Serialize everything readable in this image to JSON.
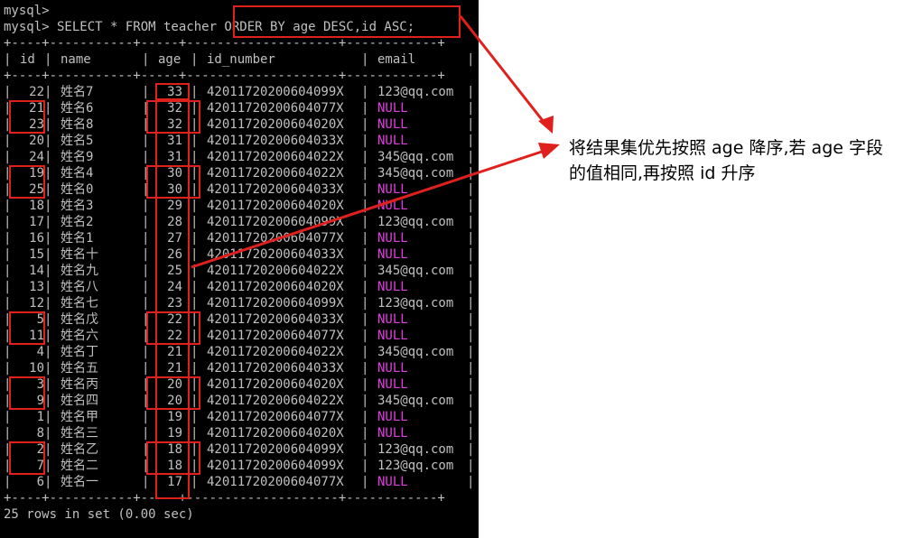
{
  "terminal": {
    "prompt_lines": [
      "mysql>",
      "mysql> SELECT * FROM teacher ORDER BY age DESC,id ASC;"
    ],
    "border_line": "+----+-----------+-----+--------------------+------------+",
    "header": {
      "id": "id",
      "name": "name",
      "age": "age",
      "id_number": "id_number",
      "email": "email"
    },
    "rows": [
      {
        "id": "22",
        "name": "姓名7",
        "age": "33",
        "id_number": "42011720200604099X",
        "email": "123@qq.com"
      },
      {
        "id": "21",
        "name": "姓名6",
        "age": "32",
        "id_number": "42011720200604077X",
        "email": "NULL"
      },
      {
        "id": "23",
        "name": "姓名8",
        "age": "32",
        "id_number": "42011720200604020X",
        "email": "NULL"
      },
      {
        "id": "20",
        "name": "姓名5",
        "age": "31",
        "id_number": "42011720200604033X",
        "email": "NULL"
      },
      {
        "id": "24",
        "name": "姓名9",
        "age": "31",
        "id_number": "42011720200604022X",
        "email": "345@qq.com"
      },
      {
        "id": "19",
        "name": "姓名4",
        "age": "30",
        "id_number": "42011720200604022X",
        "email": "345@qq.com"
      },
      {
        "id": "25",
        "name": "姓名0",
        "age": "30",
        "id_number": "42011720200604033X",
        "email": "NULL"
      },
      {
        "id": "18",
        "name": "姓名3",
        "age": "29",
        "id_number": "42011720200604020X",
        "email": "NULL"
      },
      {
        "id": "17",
        "name": "姓名2",
        "age": "28",
        "id_number": "42011720200604099X",
        "email": "123@qq.com"
      },
      {
        "id": "16",
        "name": "姓名1",
        "age": "27",
        "id_number": "42011720200604077X",
        "email": "NULL"
      },
      {
        "id": "15",
        "name": "姓名十",
        "age": "26",
        "id_number": "42011720200604033X",
        "email": "NULL"
      },
      {
        "id": "14",
        "name": "姓名九",
        "age": "25",
        "id_number": "42011720200604022X",
        "email": "345@qq.com"
      },
      {
        "id": "13",
        "name": "姓名八",
        "age": "24",
        "id_number": "42011720200604020X",
        "email": "NULL"
      },
      {
        "id": "12",
        "name": "姓名七",
        "age": "23",
        "id_number": "42011720200604099X",
        "email": "123@qq.com"
      },
      {
        "id": "5",
        "name": "姓名戊",
        "age": "22",
        "id_number": "42011720200604033X",
        "email": "NULL"
      },
      {
        "id": "11",
        "name": "姓名六",
        "age": "22",
        "id_number": "42011720200604077X",
        "email": "NULL"
      },
      {
        "id": "4",
        "name": "姓名丁",
        "age": "21",
        "id_number": "42011720200604022X",
        "email": "345@qq.com"
      },
      {
        "id": "10",
        "name": "姓名五",
        "age": "21",
        "id_number": "42011720200604033X",
        "email": "NULL"
      },
      {
        "id": "3",
        "name": "姓名丙",
        "age": "20",
        "id_number": "42011720200604020X",
        "email": "NULL"
      },
      {
        "id": "9",
        "name": "姓名四",
        "age": "20",
        "id_number": "42011720200604022X",
        "email": "345@qq.com"
      },
      {
        "id": "1",
        "name": "姓名甲",
        "age": "19",
        "id_number": "42011720200604077X",
        "email": "NULL"
      },
      {
        "id": "8",
        "name": "姓名三",
        "age": "19",
        "id_number": "42011720200604020X",
        "email": "NULL"
      },
      {
        "id": "2",
        "name": "姓名乙",
        "age": "18",
        "id_number": "42011720200604099X",
        "email": "123@qq.com"
      },
      {
        "id": "7",
        "name": "姓名二",
        "age": "18",
        "id_number": "42011720200604099X",
        "email": "123@qq.com"
      },
      {
        "id": "6",
        "name": "姓名一",
        "age": "17",
        "id_number": "42011720200604077X",
        "email": "NULL"
      }
    ],
    "footer": "25 rows in set (0.00 sec)",
    "null_color": "#e23ce0",
    "text_color": "#c0c0c0"
  },
  "annotation": {
    "text": "将结果集优先按照 age 降序,若 age 字段的值相同,再按照 id 升序",
    "color": "#e0201c"
  }
}
